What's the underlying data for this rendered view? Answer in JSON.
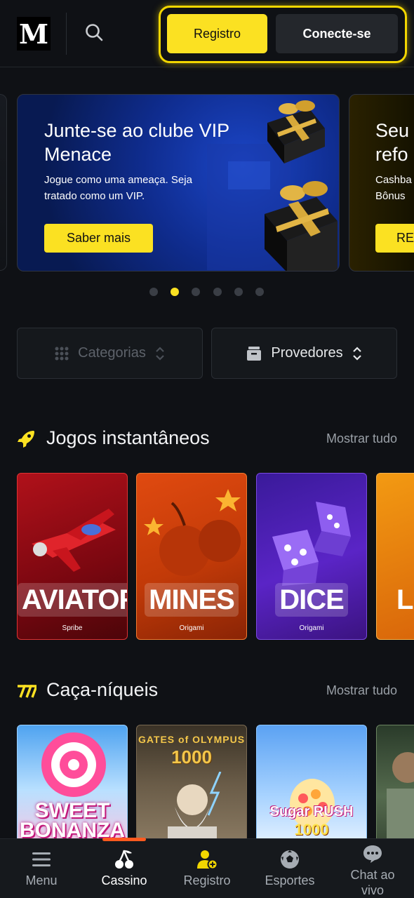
{
  "header": {
    "logo_text": "M",
    "register_label": "Registro",
    "login_label": "Conecte-se"
  },
  "carousel": {
    "banners": [
      {
        "title": "Junte-se ao clube VIP Menace",
        "subtitle": "Jogue como uma ameaça. Seja tratado como um VIP.",
        "cta": "Saber mais"
      },
      {
        "title_line1": "Seu",
        "title_line2": "refo",
        "sub_line1": "Cashba",
        "sub_line2": "Bônus",
        "cta": "RE"
      }
    ],
    "total_dots": 6,
    "active_index": 1
  },
  "filters": {
    "categories_label": "Categorias",
    "providers_label": "Provedores"
  },
  "sections": {
    "instant": {
      "title": "Jogos instantâneos",
      "show_all": "Mostrar tudo",
      "games": [
        {
          "name": "AVIATOR",
          "provider": "Spribe"
        },
        {
          "name": "MINES",
          "provider": "Origami"
        },
        {
          "name": "DICE",
          "provider": "Origami"
        },
        {
          "name": "L",
          "provider": ""
        }
      ]
    },
    "slots": {
      "title": "Caça-níqueis",
      "show_all": "Mostrar tudo",
      "games": [
        {
          "line1": "SWEET",
          "line2": "BONANZA"
        },
        {
          "line1": "GATES of OLYMPUS",
          "line2": "1000"
        },
        {
          "line1": "Sugar RUSH",
          "line2": "1000"
        },
        {
          "line1": "",
          "line2": ""
        }
      ]
    }
  },
  "bottom_nav": {
    "items": [
      {
        "label": "Menu",
        "icon": "hamburger-icon"
      },
      {
        "label": "Cassino",
        "icon": "cherry-icon"
      },
      {
        "label": "Registro",
        "icon": "user-add-icon"
      },
      {
        "label": "Esportes",
        "icon": "soccer-ball-icon"
      },
      {
        "label": "Chat ao vivo",
        "icon": "chat-icon"
      }
    ],
    "active_index": 1
  },
  "colors": {
    "accent": "#fbe122",
    "background": "#0f1115",
    "active_indicator": "#ff5a1f"
  }
}
